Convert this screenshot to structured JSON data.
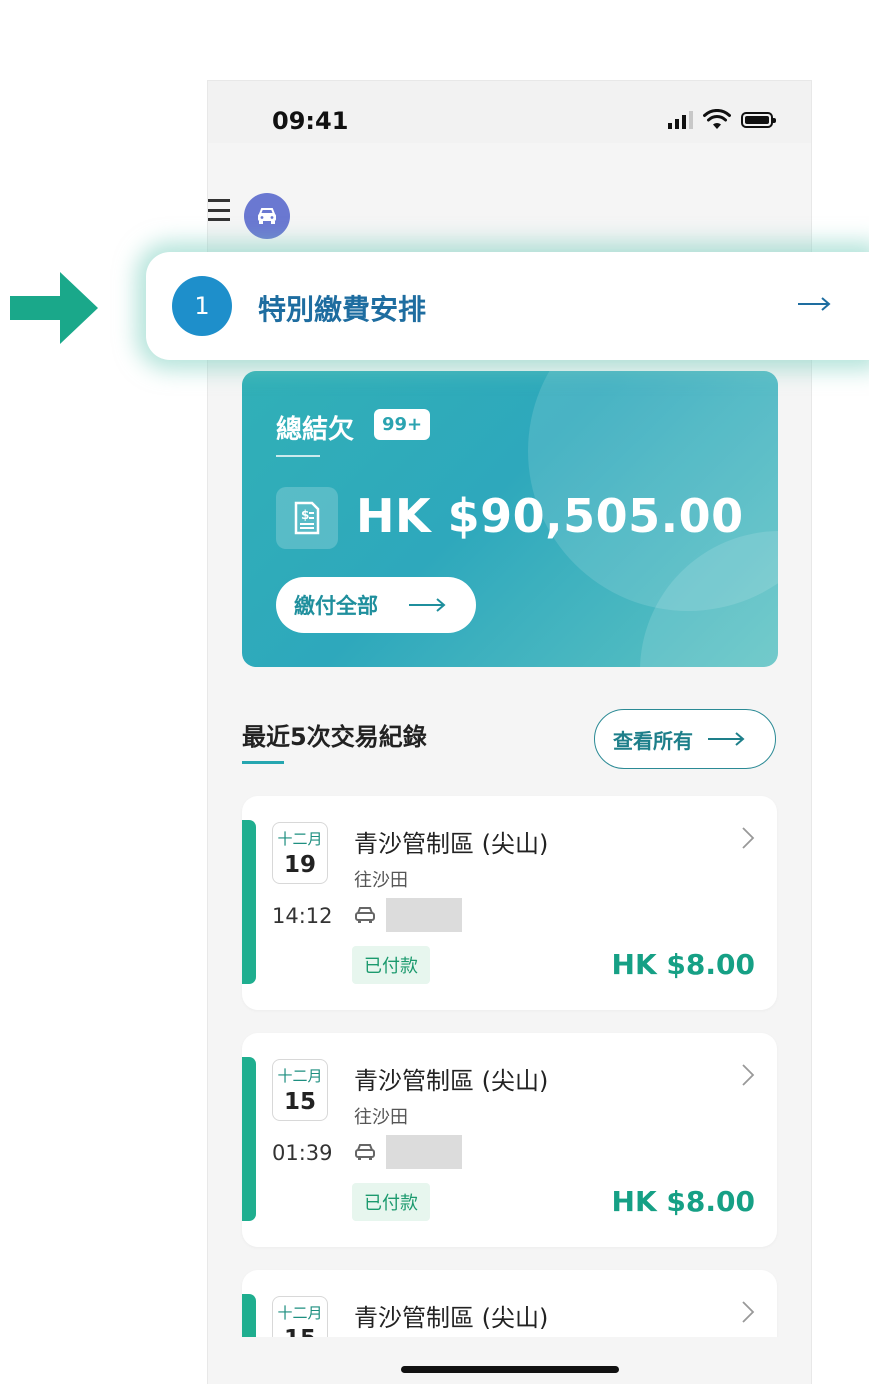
{
  "status_bar": {
    "time": "09:41"
  },
  "highlight": {
    "step_number": "1",
    "label": "特別繳費安排"
  },
  "summary": {
    "title": "總結欠",
    "badge": "99+",
    "amount": "HK $90,505.00",
    "pay_all_label": "繳付全部"
  },
  "recent": {
    "title": "最近5次交易紀錄",
    "view_all_label": "查看所有"
  },
  "transactions": [
    {
      "month": "十二月",
      "day": "19",
      "time": "14:12",
      "location": "青沙管制區 (尖山)",
      "direction": "往沙田",
      "status": "已付款",
      "amount": "HK $8.00"
    },
    {
      "month": "十二月",
      "day": "15",
      "time": "01:39",
      "location": "青沙管制區 (尖山)",
      "direction": "往沙田",
      "status": "已付款",
      "amount": "HK $8.00"
    },
    {
      "month": "十二月",
      "day": "15",
      "location": "青沙管制區 (尖山)"
    }
  ],
  "colors": {
    "accent_teal": "#25a6b0",
    "paid_green": "#16a085",
    "highlight_blue": "#1e8fcb",
    "pointer_green": "#1aa88a"
  },
  "icons": [
    "menu-icon",
    "car-icon",
    "document-dollar-icon",
    "arrow-right-icon",
    "chevron-right-icon",
    "signal-icon",
    "wifi-icon",
    "battery-icon"
  ]
}
